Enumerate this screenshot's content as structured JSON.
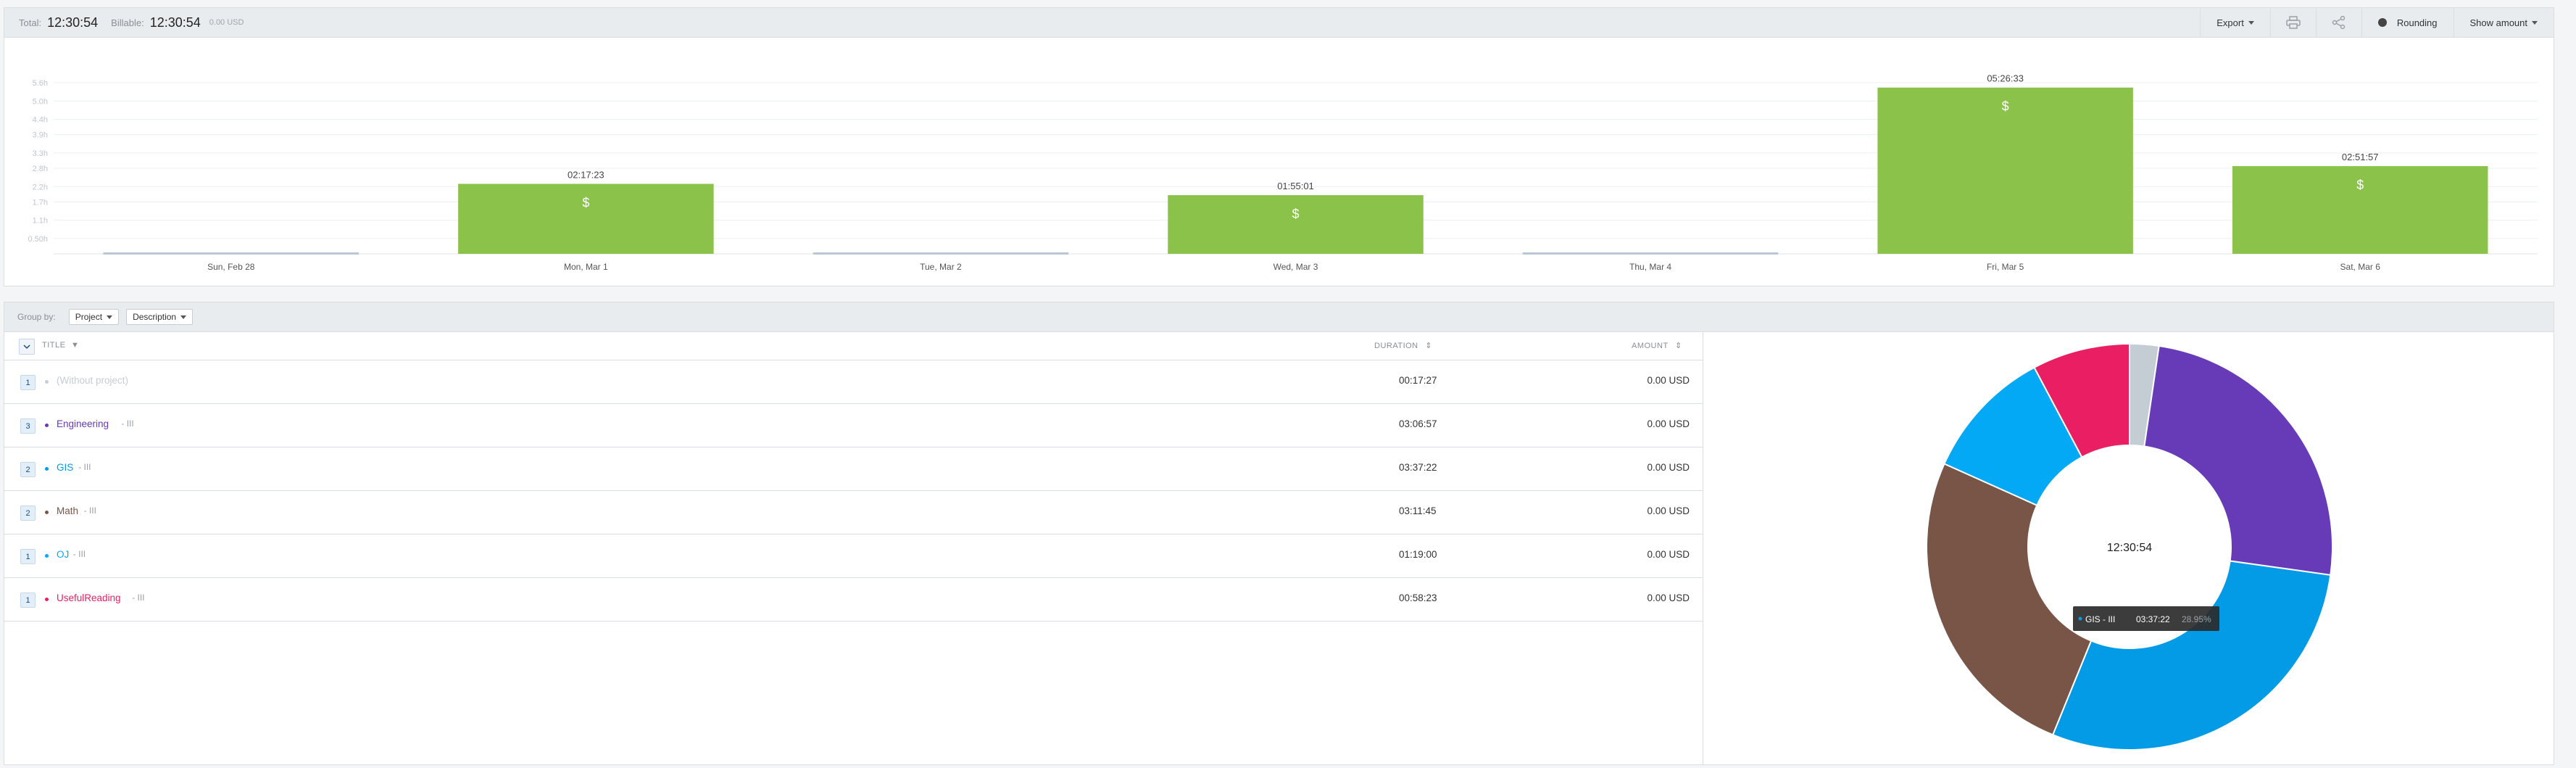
{
  "summary": {
    "total_label": "Total:",
    "total_value": "12:30:54",
    "billable_label": "Billable:",
    "billable_value": "12:30:54",
    "amount_value": "0.00 USD"
  },
  "toolbar": {
    "export_label": "Export",
    "print_icon": "printer-icon",
    "share_icon": "share-icon",
    "rounding_label": "Rounding",
    "show_amount_label": "Show amount"
  },
  "chart_data": [
    {
      "type": "bar",
      "categories": [
        "Sun, Feb 28",
        "Mon, Mar 1",
        "Tue, Mar 2",
        "Wed, Mar 3",
        "Thu, Mar 4",
        "Fri, Mar 5",
        "Sat, Mar 6"
      ],
      "values_hours": [
        0,
        2.29,
        0,
        1.92,
        0,
        5.44,
        2.87
      ],
      "data_labels": [
        "",
        "02:17:23",
        "",
        "01:55:01",
        "",
        "05:26:33",
        "02:51:57"
      ],
      "bar_symbol": "$",
      "yticks": [
        "0.50h",
        "1.1h",
        "1.7h",
        "2.2h",
        "2.8h",
        "3.3h",
        "3.9h",
        "4.4h",
        "5.0h",
        "5.6h"
      ],
      "ytick_values": [
        0.5,
        1.1,
        1.7,
        2.2,
        2.8,
        3.3,
        3.9,
        4.4,
        5.0,
        5.6
      ],
      "ylim": [
        0,
        5.6
      ],
      "grid": true,
      "colors": {
        "bar": "#8bc34a",
        "empty": "#b8c8d6"
      }
    },
    {
      "type": "pie",
      "center_label": "12:30:54",
      "labels": [
        "(Without project)",
        "Engineering",
        "GIS",
        "Math",
        "OJ",
        "UsefulReading"
      ],
      "values_seconds": [
        1047,
        11217,
        13042,
        11505,
        4740,
        3503
      ],
      "colors": [
        "#c5cdd4",
        "#673ab7",
        "#039be5",
        "#795548",
        "#03a9f4",
        "#e91e63"
      ],
      "tooltip": {
        "name": "GIS - III",
        "duration": "03:37:22",
        "percent": "28.95%"
      }
    }
  ],
  "report": {
    "group_by_label": "Group by:",
    "group_primary": "Project",
    "group_secondary": "Description",
    "col_title": "TITLE",
    "col_duration": "DURATION",
    "col_amount": "AMOUNT",
    "rows": [
      {
        "count": "1",
        "name": "(Without project)",
        "more": "",
        "duration": "00:17:27",
        "amount": "0.00 USD",
        "color": "#c5cdd4"
      },
      {
        "count": "3",
        "name": "Engineering",
        "more": "- III",
        "duration": "03:06:57",
        "amount": "0.00 USD",
        "color": "#673ab7"
      },
      {
        "count": "2",
        "name": "GIS",
        "more": "- III",
        "duration": "03:37:22",
        "amount": "0.00 USD",
        "color": "#039be5"
      },
      {
        "count": "2",
        "name": "Math",
        "more": "- III",
        "duration": "03:11:45",
        "amount": "0.00 USD",
        "color": "#795548"
      },
      {
        "count": "1",
        "name": "OJ",
        "more": "- III",
        "duration": "01:19:00",
        "amount": "0.00 USD",
        "color": "#03a9f4"
      },
      {
        "count": "1",
        "name": "UsefulReading",
        "more": "- III",
        "duration": "00:58:23",
        "amount": "0.00 USD",
        "color": "#e91e63"
      }
    ]
  }
}
